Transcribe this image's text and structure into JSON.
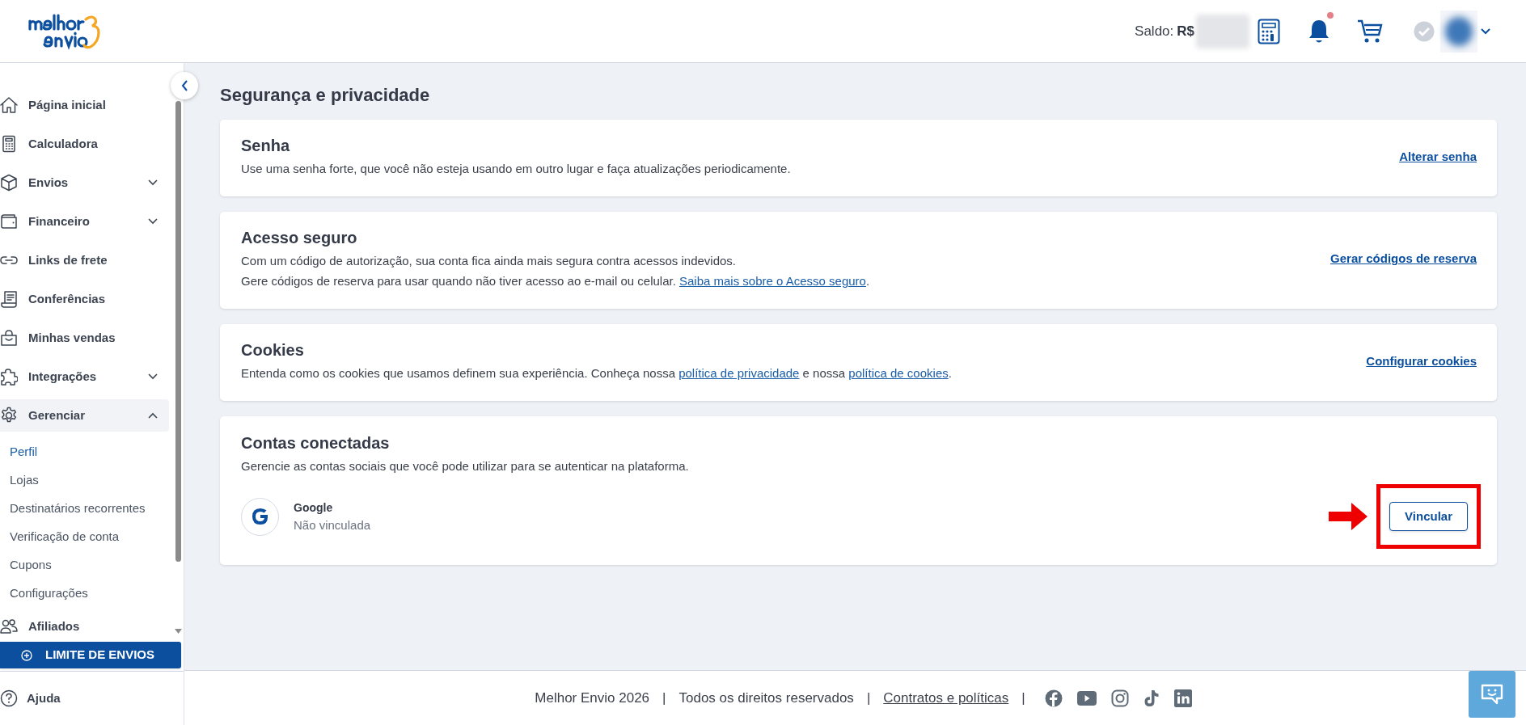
{
  "header": {
    "balance_label": "Saldo:",
    "currency": "R$",
    "notifications_unread": true
  },
  "sidebar": {
    "items": [
      {
        "kind": "link",
        "label": "Página inicial"
      },
      {
        "kind": "link",
        "label": "Calculadora"
      },
      {
        "kind": "group",
        "label": "Envios",
        "expanded": false
      },
      {
        "kind": "group",
        "label": "Financeiro",
        "expanded": false
      },
      {
        "kind": "link",
        "label": "Links de frete"
      },
      {
        "kind": "link",
        "label": "Conferências"
      },
      {
        "kind": "link",
        "label": "Minhas vendas"
      },
      {
        "kind": "group",
        "label": "Integrações",
        "expanded": false
      },
      {
        "kind": "group",
        "label": "Gerenciar",
        "expanded": true,
        "children": [
          {
            "label": "Perfil",
            "selected": true
          },
          {
            "label": "Lojas",
            "selected": false
          },
          {
            "label": "Destinatários recorrentes",
            "selected": false
          },
          {
            "label": "Verificação de conta",
            "selected": false
          },
          {
            "label": "Cupons",
            "selected": false
          },
          {
            "label": "Configurações",
            "selected": false
          }
        ]
      },
      {
        "kind": "link",
        "label": "Afiliados"
      }
    ],
    "limit_button": "LIMITE DE ENVIOS",
    "help": "Ajuda"
  },
  "page_title": "Segurança e privacidade",
  "cards": [
    {
      "kind": "action",
      "title": "Senha",
      "lines": [
        [
          {
            "text": "Use uma senha forte, que você não esteja usando em outro lugar e faça atualizações periodicamente."
          }
        ]
      ],
      "action": "Alterar senha"
    },
    {
      "kind": "action",
      "title": "Acesso seguro",
      "lines": [
        [
          {
            "text": "Com um código de autorização, sua conta fica ainda mais segura contra acessos indevidos."
          }
        ],
        [
          {
            "text": "Gere códigos de reserva para usar quando não tiver acesso ao e-mail ou celular. "
          },
          {
            "link": "Saiba mais sobre o Acesso seguro"
          },
          {
            "text": "."
          }
        ]
      ],
      "action": "Gerar códigos de reserva"
    },
    {
      "kind": "action",
      "title": "Cookies",
      "lines": [
        [
          {
            "text": "Entenda como os cookies que usamos definem sua experiência. Conheça nossa "
          },
          {
            "link": "política de privacidade"
          },
          {
            "text": " e nossa "
          },
          {
            "link": "política de cookies"
          },
          {
            "text": "."
          }
        ]
      ],
      "action": "Configurar cookies"
    },
    {
      "kind": "accounts",
      "title": "Contas conectadas",
      "lines": [
        [
          {
            "text": "Gerencie as contas sociais que você pode utilizar para se autenticar na plataforma."
          }
        ]
      ],
      "accounts": [
        {
          "name": "Google",
          "status": "Não vinculada",
          "button": "Vincular",
          "highlighted": true
        }
      ]
    }
  ],
  "footer": [
    {
      "kind": "text",
      "text": "Melhor Envio 2026"
    },
    {
      "kind": "separator",
      "text": "|"
    },
    {
      "kind": "text",
      "text": "Todos os direitos reservados"
    },
    {
      "kind": "separator",
      "text": "|"
    },
    {
      "kind": "link",
      "text": "Contratos e políticas"
    },
    {
      "kind": "separator",
      "text": "|"
    }
  ]
}
